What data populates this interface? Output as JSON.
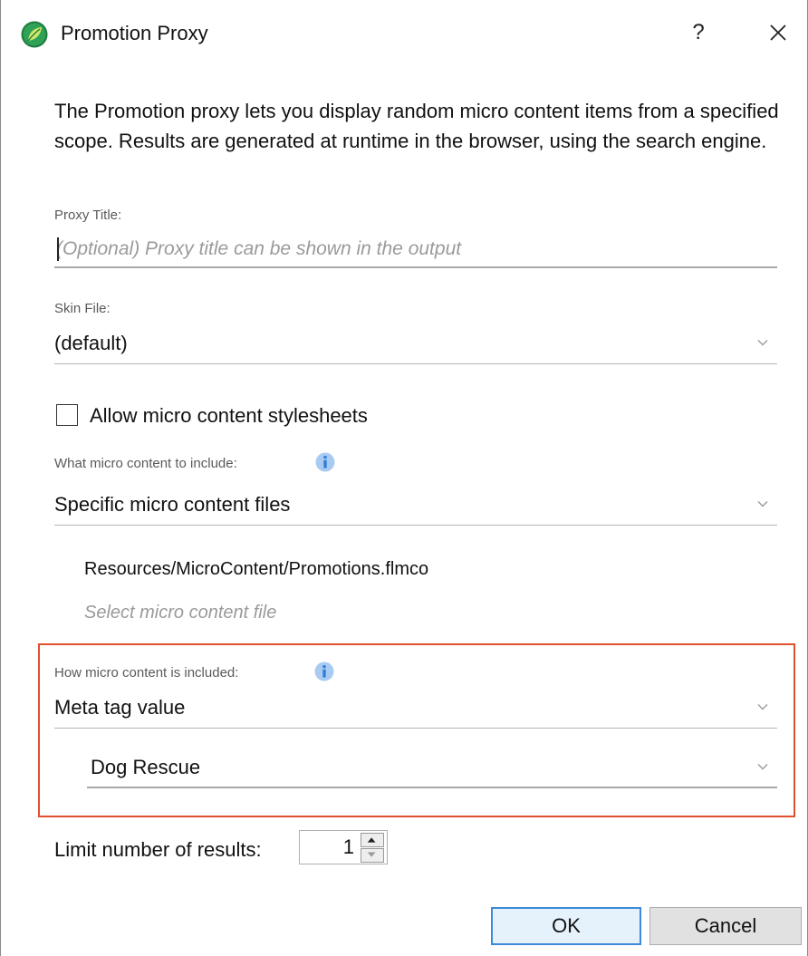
{
  "window": {
    "title": "Promotion Proxy",
    "help_label": "?",
    "app_icon": "leaf-icon",
    "accent_color": "#1e8a4a"
  },
  "description": "The Promotion proxy lets you display random micro content items from a specified scope. Results are generated at runtime in the browser, using the search engine.",
  "proxy_title": {
    "label": "Proxy Title:",
    "placeholder": "(Optional) Proxy title can be shown in the output",
    "value": ""
  },
  "skin_file": {
    "label": "Skin File:",
    "selected": "(default)"
  },
  "allow_stylesheets": {
    "label": "Allow micro content stylesheets",
    "checked": false
  },
  "include_what": {
    "label": "What micro content to include:",
    "selected": "Specific micro content files",
    "files": [
      "Resources/MicroContent/Promotions.flmco"
    ],
    "select_file_label": "Select micro content file"
  },
  "include_how": {
    "label": "How micro content is included:",
    "selected": "Meta tag value",
    "meta_value": "Dog Rescue",
    "highlight_color": "#e0502e"
  },
  "limit": {
    "label": "Limit number of results:",
    "value": "1"
  },
  "buttons": {
    "ok": "OK",
    "cancel": "Cancel"
  }
}
